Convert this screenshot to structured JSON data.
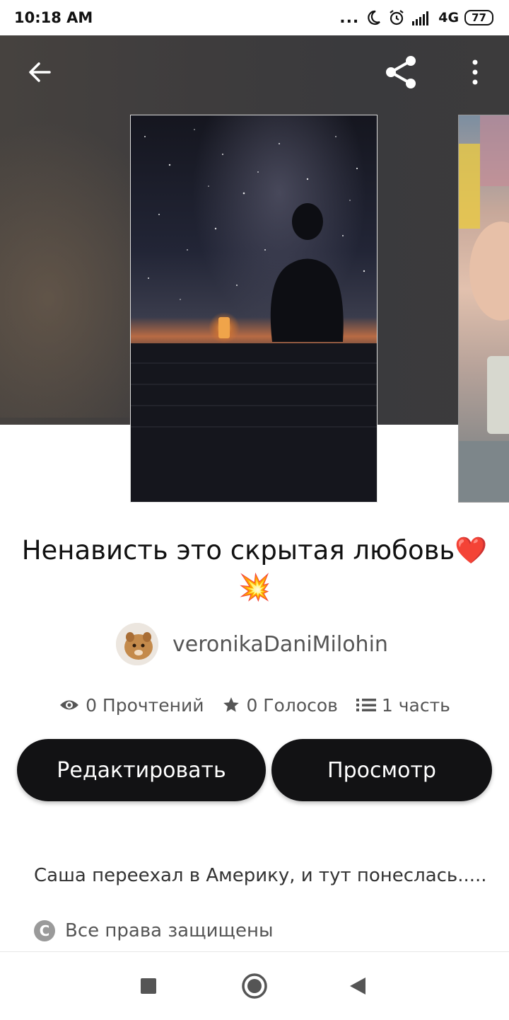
{
  "status_bar": {
    "time": "10:18 AM",
    "dots": "...",
    "network": "4G",
    "battery": "77",
    "icons": [
      "moon-icon",
      "alarm-icon",
      "signal-icon"
    ]
  },
  "app_bar": {
    "icons": [
      "back-arrow-icon",
      "share-icon",
      "more-vert-icon"
    ]
  },
  "story": {
    "title": "Ненависть это скрытая любовь❤️",
    "title_emoji": "💥",
    "author": "veronikaDaniMilohin",
    "stats": {
      "reads": "0 Прочтений",
      "votes": "0 Голосов",
      "parts": "1 часть"
    },
    "buttons": {
      "edit": "Редактировать",
      "view": "Просмотр"
    },
    "description": "Саша переехал в Америку, и тут понеслась.....",
    "copyright": "Все права защищены"
  },
  "colors": {
    "button_bg": "#121214",
    "hero_bg": "#3e3c3d"
  }
}
